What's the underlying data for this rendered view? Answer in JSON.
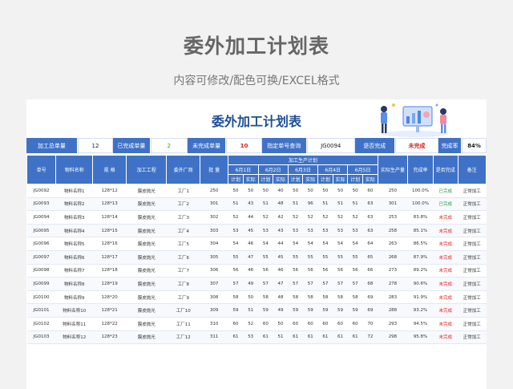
{
  "page": {
    "title": "委外加工计划表",
    "subtitle": "内容可修改/配色可换/EXCEL格式"
  },
  "sheet": {
    "title": "委外加工计划表",
    "summary": [
      {
        "label": "加工总单量",
        "value": "12"
      },
      {
        "label": "已完成单量",
        "value": "2"
      },
      {
        "label": "未完成单量",
        "value": "10"
      },
      {
        "label": "指定单号查询",
        "value": "JG0094"
      },
      {
        "label": "是否完成",
        "value": "未完成"
      },
      {
        "label": "完成率",
        "value": "84%"
      }
    ],
    "colors": {
      "header": "#3f72c7",
      "done": "#2b9a3e",
      "not_done": "#e02222",
      "title": "#1e4f96"
    },
    "headers": {
      "order_no": "单号",
      "material": "物料名称",
      "spec": "规 格",
      "process": "加工工程",
      "vendor": "委外厂商",
      "qty": "批 量",
      "plan_group": "加工生产计划",
      "days": [
        "6月1日",
        "6月2日",
        "6月3日",
        "6月4日",
        "6月5日"
      ],
      "plan": "计划",
      "actual": "实际",
      "actual_output": "实际生产量",
      "rate": "完成率",
      "is_done": "是否完成",
      "note": "备注"
    },
    "rows": [
      {
        "id": "JG0092",
        "material": "物料名称1",
        "spec": "128*12",
        "process": "膜皮抛光",
        "vendor": "工厂1",
        "qty": "250",
        "d": [
          "50",
          "50",
          "50",
          "40",
          "50",
          "50",
          "50",
          "50",
          "50",
          "60"
        ],
        "output": "250",
        "rate": "100.0%",
        "done": "已完成",
        "note": "正常加工"
      },
      {
        "id": "JG0093",
        "material": "物料名称2",
        "spec": "128*13",
        "process": "膜皮抛光",
        "vendor": "工厂2",
        "qty": "301",
        "d": [
          "51",
          "43",
          "51",
          "48",
          "51",
          "96",
          "51",
          "51",
          "51",
          "63"
        ],
        "output": "301",
        "rate": "100.0%",
        "done": "已完成",
        "note": "正常加工"
      },
      {
        "id": "JG0094",
        "material": "物料名称3",
        "spec": "128*14",
        "process": "膜皮抛光",
        "vendor": "工厂3",
        "qty": "302",
        "d": [
          "52",
          "44",
          "52",
          "42",
          "52",
          "52",
          "52",
          "52",
          "52",
          "63"
        ],
        "output": "253",
        "rate": "83.8%",
        "done": "未完成",
        "note": "正常加工"
      },
      {
        "id": "JG0095",
        "material": "物料名称4",
        "spec": "128*15",
        "process": "膜皮抛光",
        "vendor": "工厂4",
        "qty": "303",
        "d": [
          "53",
          "45",
          "53",
          "43",
          "53",
          "53",
          "53",
          "53",
          "53",
          "63"
        ],
        "output": "258",
        "rate": "85.1%",
        "done": "未完成",
        "note": "正常加工"
      },
      {
        "id": "JG0096",
        "material": "物料名称5",
        "spec": "128*16",
        "process": "膜皮抛光",
        "vendor": "工厂5",
        "qty": "304",
        "d": [
          "54",
          "46",
          "54",
          "44",
          "54",
          "54",
          "54",
          "54",
          "54",
          "64"
        ],
        "output": "263",
        "rate": "86.5%",
        "done": "未完成",
        "note": "正常加工"
      },
      {
        "id": "JG0097",
        "material": "物料名称6",
        "spec": "128*17",
        "process": "膜皮抛光",
        "vendor": "工厂6",
        "qty": "305",
        "d": [
          "55",
          "47",
          "55",
          "45",
          "55",
          "55",
          "55",
          "55",
          "55",
          "65"
        ],
        "output": "268",
        "rate": "87.9%",
        "done": "未完成",
        "note": "正常加工"
      },
      {
        "id": "JG0098",
        "material": "物料名称7",
        "spec": "128*18",
        "process": "膜皮抛光",
        "vendor": "工厂7",
        "qty": "306",
        "d": [
          "56",
          "46",
          "56",
          "46",
          "56",
          "56",
          "56",
          "56",
          "56",
          "66"
        ],
        "output": "273",
        "rate": "89.2%",
        "done": "未完成",
        "note": "正常加工"
      },
      {
        "id": "JG0099",
        "material": "物料名称8",
        "spec": "128*19",
        "process": "膜皮抛光",
        "vendor": "工厂8",
        "qty": "307",
        "d": [
          "57",
          "49",
          "57",
          "47",
          "57",
          "57",
          "57",
          "57",
          "57",
          "68"
        ],
        "output": "278",
        "rate": "90.6%",
        "done": "未完成",
        "note": "正常加工"
      },
      {
        "id": "JG0100",
        "material": "物料名称9",
        "spec": "128*20",
        "process": "膜皮抛光",
        "vendor": "工厂9",
        "qty": "308",
        "d": [
          "58",
          "50",
          "58",
          "48",
          "58",
          "58",
          "58",
          "58",
          "58",
          "69"
        ],
        "output": "283",
        "rate": "91.9%",
        "done": "未完成",
        "note": "正常加工"
      },
      {
        "id": "JG0101",
        "material": "物料名称10",
        "spec": "128*21",
        "process": "膜皮抛光",
        "vendor": "工厂10",
        "qty": "309",
        "d": [
          "59",
          "51",
          "59",
          "49",
          "59",
          "59",
          "59",
          "59",
          "59",
          "69"
        ],
        "output": "288",
        "rate": "93.2%",
        "done": "未完成",
        "note": "正常加工"
      },
      {
        "id": "JG0102",
        "material": "物料名称11",
        "spec": "128*22",
        "process": "膜皮抛光",
        "vendor": "工厂11",
        "qty": "310",
        "d": [
          "60",
          "52",
          "60",
          "50",
          "60",
          "60",
          "60",
          "60",
          "60",
          "70"
        ],
        "output": "293",
        "rate": "94.5%",
        "done": "未完成",
        "note": "正常加工"
      },
      {
        "id": "JG0103",
        "material": "物料名称12",
        "spec": "128*23",
        "process": "膜皮抛光",
        "vendor": "工厂12",
        "qty": "311",
        "d": [
          "61",
          "53",
          "61",
          "51",
          "61",
          "61",
          "61",
          "61",
          "61",
          "72"
        ],
        "output": "298",
        "rate": "95.8%",
        "done": "未完成",
        "note": "正常加工"
      }
    ]
  }
}
